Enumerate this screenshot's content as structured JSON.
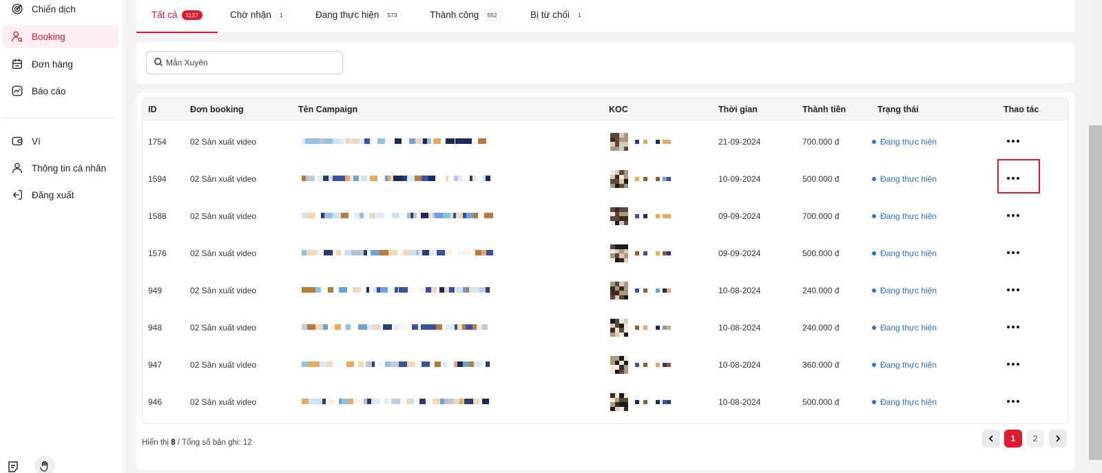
{
  "sidebar": {
    "items": [
      {
        "label": "Chiến dịch",
        "icon": "target-icon",
        "active": false
      },
      {
        "label": "Booking",
        "icon": "user-search-icon",
        "active": true
      },
      {
        "label": "Đơn hàng",
        "icon": "calendar-icon",
        "active": false
      },
      {
        "label": "Báo cáo",
        "icon": "chart-icon",
        "active": false
      },
      {
        "label": "Ví",
        "icon": "wallet-icon",
        "active": false
      },
      {
        "label": "Thông tin cá nhân",
        "icon": "user-icon",
        "active": false
      },
      {
        "label": "Đăng xuất",
        "icon": "logout-icon",
        "active": false
      }
    ]
  },
  "tabs": [
    {
      "label": "Tất cả",
      "count": "1127",
      "active": true
    },
    {
      "label": "Chờ nhận",
      "count": "1",
      "active": false
    },
    {
      "label": "Đang thực hiện",
      "count": "573",
      "active": false
    },
    {
      "label": "Thành công",
      "count": "552",
      "active": false
    },
    {
      "label": "Bị từ chối",
      "count": "1",
      "active": false
    }
  ],
  "search": {
    "value": "Mẫn Xuyên"
  },
  "table": {
    "headers": {
      "id": "ID",
      "booking": "Đơn booking",
      "campaign": "Tên Campaign",
      "koc": "KOC",
      "time": "Thời gian",
      "amount": "Thành tiền",
      "status": "Trạng thái",
      "actions": "Thao tác"
    },
    "rows": [
      {
        "id": "1754",
        "booking": "02 Sản xuất video",
        "time": "21-09-2024",
        "amount": "700.000 đ",
        "status": "Đang thực hiện"
      },
      {
        "id": "1594",
        "booking": "02 Sản xuất video",
        "time": "10-09-2024",
        "amount": "500.000 đ",
        "status": "Đang thực hiện"
      },
      {
        "id": "1588",
        "booking": "02 Sản xuất video",
        "time": "09-09-2024",
        "amount": "700.000 đ",
        "status": "Đang thực hiện"
      },
      {
        "id": "1576",
        "booking": "02 Sản xuất video",
        "time": "09-09-2024",
        "amount": "500.000 đ",
        "status": "Đang thực hiện"
      },
      {
        "id": "949",
        "booking": "02 Sản xuất video",
        "time": "10-08-2024",
        "amount": "240.000 đ",
        "status": "Đang thực hiện"
      },
      {
        "id": "948",
        "booking": "02 Sản xuất video",
        "time": "10-08-2024",
        "amount": "240.000 đ",
        "status": "Đang thực hiện"
      },
      {
        "id": "947",
        "booking": "02 Sản xuất video",
        "time": "10-08-2024",
        "amount": "360.000 đ",
        "status": "Đang thực hiện"
      },
      {
        "id": "946",
        "booking": "02 Sản xuất video",
        "time": "10-08-2024",
        "amount": "500.000 đ",
        "status": "Đang thực hiện"
      }
    ]
  },
  "footer": {
    "prefix": "Hiển thị",
    "shown": "8",
    "suffix": "/ Tổng số bản ghi: 12"
  },
  "pagination": {
    "pages": [
      "1",
      "2"
    ],
    "current": "1"
  },
  "colors": {
    "accent": "#e0192f",
    "status": "#2f6bde"
  }
}
